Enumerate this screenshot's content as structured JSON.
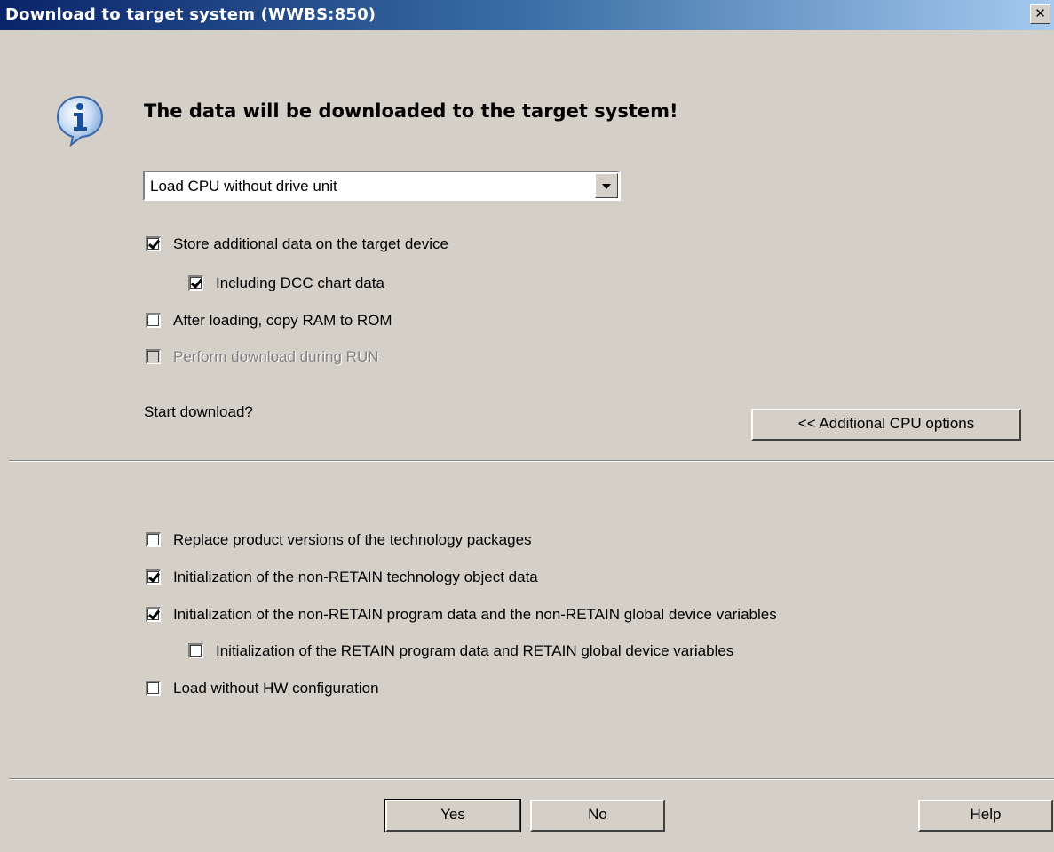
{
  "window": {
    "title": "Download to target system (WWBS:850)",
    "close_glyph": "✕"
  },
  "message": {
    "icon": "info-icon",
    "headline": "The data will be downloaded to the target system!",
    "question": "Start download?"
  },
  "load_mode": {
    "selected": "Load CPU without drive unit"
  },
  "options": [
    {
      "label": "Store additional data on the target device",
      "checked": true,
      "enabled": true
    },
    {
      "label": "Including DCC chart data",
      "checked": true,
      "enabled": true
    },
    {
      "label": "After loading, copy RAM to ROM",
      "checked": false,
      "enabled": true
    },
    {
      "label": "Perform download during RUN",
      "checked": false,
      "enabled": false
    }
  ],
  "additional_button": "<< Additional CPU options",
  "cpu_options": [
    {
      "label": "Replace product versions of the technology packages",
      "checked": false
    },
    {
      "label": "Initialization of the non-RETAIN technology object data",
      "checked": true
    },
    {
      "label": "Initialization of the non-RETAIN program data and the non-RETAIN global device variables",
      "checked": true
    },
    {
      "label": "Initialization of the RETAIN program data and RETAIN global device variables",
      "checked": false
    },
    {
      "label": "Load without HW configuration",
      "checked": false
    }
  ],
  "buttons": {
    "yes": "Yes",
    "no": "No",
    "help": "Help"
  }
}
